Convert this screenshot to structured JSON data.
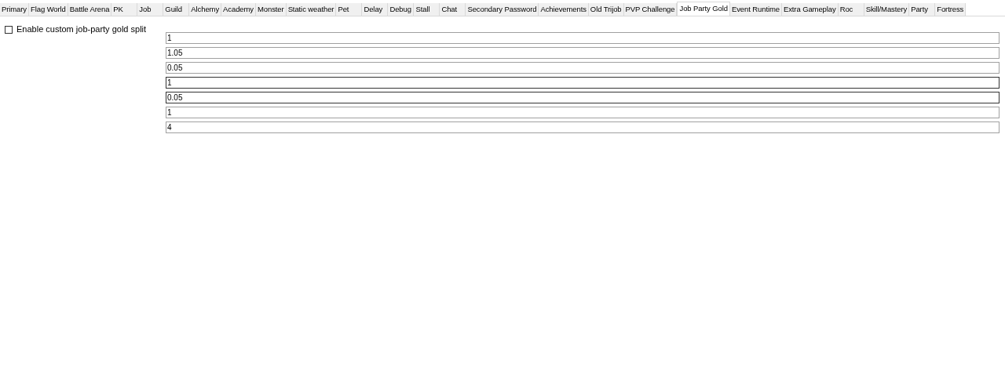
{
  "tabs": [
    {
      "label": "Primary",
      "selected": false
    },
    {
      "label": "Flag World",
      "selected": false
    },
    {
      "label": "Battle Arena",
      "selected": false
    },
    {
      "label": "PK",
      "selected": false
    },
    {
      "label": "Job",
      "selected": false
    },
    {
      "label": "Guild",
      "selected": false
    },
    {
      "label": "Alchemy",
      "selected": false
    },
    {
      "label": "Academy",
      "selected": false
    },
    {
      "label": "Monster",
      "selected": false
    },
    {
      "label": "Static weather",
      "selected": false
    },
    {
      "label": "Pet",
      "selected": false
    },
    {
      "label": "Delay",
      "selected": false
    },
    {
      "label": "Debug",
      "selected": false
    },
    {
      "label": "Stall",
      "selected": false
    },
    {
      "label": "Chat",
      "selected": false
    },
    {
      "label": "Secondary Password",
      "selected": false
    },
    {
      "label": "Achievements",
      "selected": false
    },
    {
      "label": "Old Trijob",
      "selected": false
    },
    {
      "label": "PVP Challenge",
      "selected": false
    },
    {
      "label": "Job Party Gold",
      "selected": true
    },
    {
      "label": "Event Runtime",
      "selected": false
    },
    {
      "label": "Extra Gameplay",
      "selected": false
    },
    {
      "label": "Roc",
      "selected": false
    },
    {
      "label": "Skill/Mastery",
      "selected": false
    },
    {
      "label": "Party",
      "selected": false
    },
    {
      "label": "Fortress",
      "selected": false
    }
  ],
  "checkbox": {
    "label": "Enable custom job-party gold split",
    "checked": false
  },
  "fields": [
    {
      "value": "1",
      "highlighted": false
    },
    {
      "value": "1.05",
      "highlighted": false
    },
    {
      "value": "0.05",
      "highlighted": false
    },
    {
      "value": "1",
      "highlighted": true
    },
    {
      "value": "0.05",
      "highlighted": true
    },
    {
      "value": "1",
      "highlighted": false
    },
    {
      "value": "4",
      "highlighted": false
    }
  ]
}
